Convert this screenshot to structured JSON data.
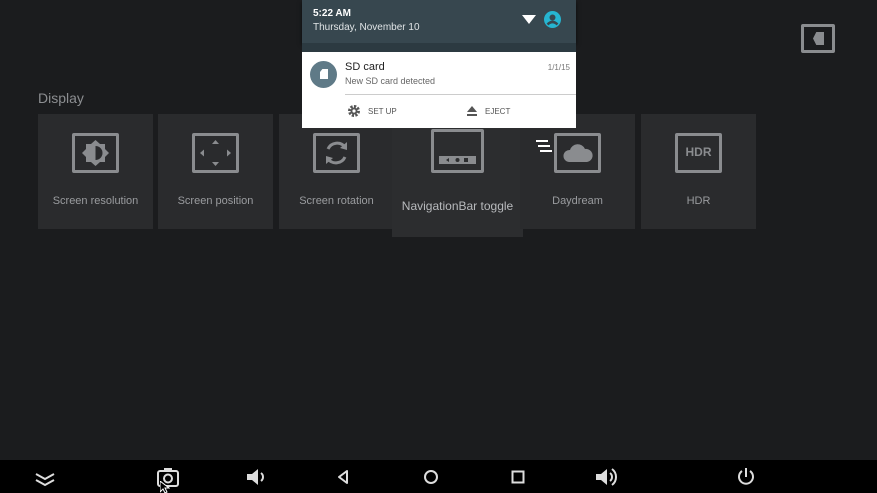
{
  "status": {
    "time": "5:22 AM",
    "date": "Thursday, November 10"
  },
  "notification": {
    "title": "SD card",
    "text": "New SD card detected",
    "when": "1/1/15",
    "actions": [
      {
        "label": "SET UP",
        "icon": "gear-icon"
      },
      {
        "label": "EJECT",
        "icon": "eject-icon"
      }
    ]
  },
  "section": {
    "title": "Display"
  },
  "tiles": [
    {
      "label": "Screen resolution",
      "icon": "brightness-icon"
    },
    {
      "label": "Screen position",
      "icon": "arrows-icon"
    },
    {
      "label": "Screen rotation",
      "icon": "rotate-icon"
    },
    {
      "label": "NavigationBar toggle",
      "icon": "navbar-icon",
      "focused": true
    },
    {
      "label": "Daydream",
      "icon": "cloud-icon"
    },
    {
      "label": "HDR",
      "icon": "hdr-icon",
      "icon_text": "HDR"
    }
  ],
  "colors": {
    "background": "#1b1c1e",
    "tile": "#2a2b2d",
    "shade": "#37474f",
    "accent": "#26b5d1"
  }
}
